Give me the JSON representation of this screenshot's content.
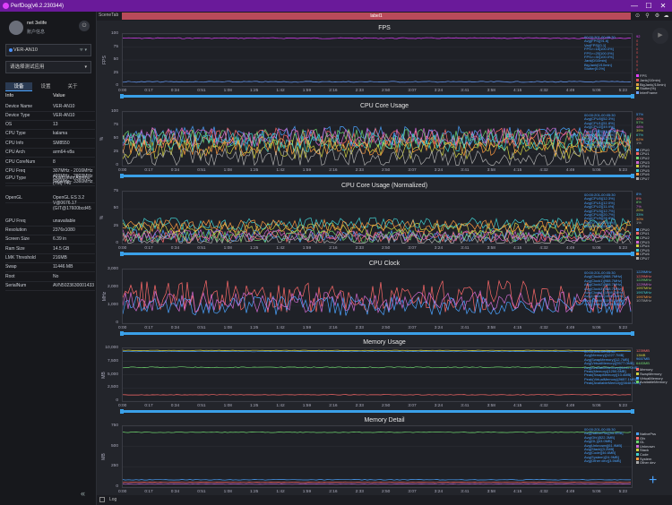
{
  "app_title": "PerfDog(v6.2.230344)",
  "window_controls": [
    "—",
    "☐",
    "✕"
  ],
  "user": {
    "name": "net 3elife",
    "verify": "账户信息"
  },
  "device": {
    "name": "VER-AN10",
    "wifi": "wifi"
  },
  "app_select": "请选择测试应用",
  "tabs": [
    "设备",
    "设置",
    "关于"
  ],
  "info_header": {
    "key": "Info",
    "value": "Value"
  },
  "info_rows": [
    {
      "k": "Device Name",
      "v": "VER-AN10"
    },
    {
      "k": "Device Type",
      "v": "VER-AN10"
    },
    {
      "k": "OS",
      "v": "13"
    },
    {
      "k": "CPU Type",
      "v": "kalama"
    },
    {
      "k": "CPU Info",
      "v": "SM8550"
    },
    {
      "k": "CPU Arch",
      "v": "arm64-v8a"
    },
    {
      "k": "CPU CoreNum",
      "v": "8"
    },
    {
      "k": "CPU Freq",
      "v": "307MHz - 2016MHz\n499MHz - 2803MHz\n595MHz - 3360MHz"
    },
    {
      "k": "GPU Type",
      "v": "Qualcomm Adreno (TM) 740"
    },
    {
      "k": "OpenGL",
      "v": "OpenGL ES 3.2 V@0676.17 (GIT@17600bcd45"
    },
    {
      "k": "GPU Freq",
      "v": "unavailable"
    },
    {
      "k": "Resolution",
      "v": "2376x1080"
    },
    {
      "k": "Screen Size",
      "v": "6.39 in"
    },
    {
      "k": "Ram Size",
      "v": "14.5 GB"
    },
    {
      "k": "LMK Threshold",
      "v": "216MB"
    },
    {
      "k": "Swap",
      "v": "11446 MB"
    },
    {
      "k": "Root",
      "v": "No"
    },
    {
      "k": "SerialNum",
      "v": "AVN5023630001433"
    }
  ],
  "toolbar": {
    "scene_tab": "SceneTab",
    "label": "label1"
  },
  "x_ticks": [
    "0:00",
    "0:17",
    "0:34",
    "0:51",
    "1:08",
    "1:25",
    "1:42",
    "1:59",
    "2:16",
    "2:33",
    "2:50",
    "3:07",
    "3:24",
    "3:41",
    "3:58",
    "4:15",
    "4:32",
    "4:49",
    "5:06",
    "5:23"
  ],
  "panels": [
    {
      "title": "FPS",
      "unit": "FPS",
      "yticks": [
        "100",
        "75",
        "50",
        "25",
        "0"
      ],
      "stats": [
        "00:00:201-00:05:30",
        "Avg(FPS)[91.6]",
        "Var(FPS)[0.1]",
        "FPS>=18[100.0%]",
        "FPS>=25[100.0%]",
        "FPS>=30[100.0%]",
        "Jank[0/10min]",
        "BigJank[0/10min]",
        "Stutter[0.0%]"
      ],
      "values": [
        "92",
        "0",
        "0",
        "0",
        "0",
        "0",
        "0",
        "0",
        "0"
      ],
      "legend": [
        {
          "n": "FPS",
          "c": "#e040fb"
        },
        {
          "n": "Jank(/10min)",
          "c": "#e05050"
        },
        {
          "n": "BigJank(/10min)",
          "c": "#e0a040"
        },
        {
          "n": "Stutter(%)",
          "c": "#d0d040"
        },
        {
          "n": "InterFrame",
          "c": "#6aa0ff"
        }
      ]
    },
    {
      "title": "CPU Core Usage",
      "unit": "%",
      "yticks": [
        "100",
        "75",
        "50",
        "25",
        "0"
      ],
      "stats": [
        "00:00:201-00:05:30",
        "Avg(CPU0)[52.3%]",
        "Avg(CPU1)[51.8%]",
        "Avg(CPU2)[49.9%]",
        "Avg(CPU3)[52.6%]",
        "Avg(CPU4)[30.1%]",
        "Avg(CPU5)[42.6%]",
        "Avg(CPU6)[36.1%]",
        "Avg(CPU7)[14.2%]"
      ],
      "values": [
        "57%",
        "40%",
        "57%",
        "48%",
        "39%",
        "67%",
        "62%",
        "1%"
      ],
      "legend": [
        {
          "n": "CPU0",
          "c": "#4aa3ff"
        },
        {
          "n": "CPU1",
          "c": "#ff6a6a"
        },
        {
          "n": "CPU2",
          "c": "#6ed36e"
        },
        {
          "n": "CPU3",
          "c": "#d06ad0"
        },
        {
          "n": "CPU4",
          "c": "#d0d040"
        },
        {
          "n": "CPU5",
          "c": "#40d0d0"
        },
        {
          "n": "CPU6",
          "c": "#ff9a40"
        },
        {
          "n": "CPU7",
          "c": "#aaaaaa"
        }
      ]
    },
    {
      "title": "CPU Core Usage (Normalized)",
      "unit": "%",
      "yticks": [
        "75",
        "50",
        "25",
        "0"
      ],
      "stats": [
        "00:00:201-00:05:30",
        "Avg(CPU0)[12.3%]",
        "Avg(CPU1)[12.0%]",
        "Avg(CPU2)[11.4%]",
        "Avg(CPU3)[12.7%]",
        "Avg(CPU4)[20.7%]",
        "Avg(CPU5)[28.8%]",
        "Avg(CPU6)[25.0%]",
        "Avg(CPU7)[5.6%]"
      ],
      "values": [
        "8%",
        "6%",
        "8%",
        "7%",
        "20%",
        "33%",
        "30%",
        "1%"
      ],
      "legend": [
        {
          "n": "CPU0",
          "c": "#4aa3ff"
        },
        {
          "n": "CPU1",
          "c": "#ff6a6a"
        },
        {
          "n": "CPU2",
          "c": "#6ed36e"
        },
        {
          "n": "CPU3",
          "c": "#d06ad0"
        },
        {
          "n": "CPU4",
          "c": "#d0d040"
        },
        {
          "n": "CPU5",
          "c": "#40d0d0"
        },
        {
          "n": "CPU6",
          "c": "#ff9a40"
        },
        {
          "n": "CPU7",
          "c": "#aaaaaa"
        }
      ]
    },
    {
      "title": "CPU Clock",
      "unit": "MHz",
      "yticks": [
        "3,000",
        "2,000",
        "1,000",
        "0"
      ],
      "stats": [
        "00:00:201-00:05:30",
        "Avg(Clock0)[988.7MHz]",
        "Avg(Clock1)[988.7MHz]",
        "Avg(Clock2)[988.7MHz]",
        "Avg(Clock3)[988.7MHz]",
        "Avg(Clock4)[1598.2MHz]",
        "Avg(Clock5)[1598.2MHz]",
        "Avg(Clock6)[1598.2MHz]",
        "Avg(Clock7)[1018.9MHz]"
      ],
      "values": [
        "1229MHz",
        "1229MHz",
        "1229MHz",
        "1229MHz",
        "1997MHz",
        "1997MHz",
        "1997MHz",
        "1075MHz"
      ],
      "legend": []
    },
    {
      "title": "Memory Usage",
      "unit": "MB",
      "yticks": [
        "10,000",
        "7,500",
        "5,000",
        "2,500",
        "0"
      ],
      "stats": [
        "00:00:201-00:05:30",
        "Avg(Memory)[1227.7MB]",
        "Avg(SwapMemory)[12.7MB]",
        "Avg(VirtualMemory)[9577.0MB]",
        "Avg(AvailableMemory)[6441.0MB]",
        "Peak(Memory)[1250.6MB]",
        "Peak(SwapMemory)[13.4MB]",
        "Peak(VirtualMemory)[9657.1MB]",
        "Peak(AvailableMemory)[6648.9MB]"
      ],
      "values": [
        "1239MB",
        "13MB",
        "9657MB",
        "6483MB"
      ],
      "legend": [
        {
          "n": "Memory",
          "c": "#ff6a6a"
        },
        {
          "n": "SwapMemory",
          "c": "#d0d040"
        },
        {
          "n": "VirtualMemory",
          "c": "#4aa3ff"
        },
        {
          "n": "AvailableMemory",
          "c": "#6ed36e"
        }
      ]
    },
    {
      "title": "Memory Detail",
      "unit": "MB",
      "yticks": [
        "750",
        "500",
        "250",
        "0"
      ],
      "stats": [
        "00:00:201-00:05:30",
        "Avg(NativePss)[95.4MB]",
        "Avg(Gfx)[522.3MB]",
        "Avg(GL)[43.0MB]",
        "Avg(Unknown)[61.9MB]",
        "Avg(Stack)[3.2MB]",
        "Avg(Code)[46.6MB]",
        "Avg(System)[24.9MB]",
        "Avg(Other dev)[3.5MB]"
      ],
      "values": [],
      "legend": [
        {
          "n": "NativePss",
          "c": "#4aa3ff"
        },
        {
          "n": "Gfx",
          "c": "#ff6a6a"
        },
        {
          "n": "GL",
          "c": "#6ed36e"
        },
        {
          "n": "Unknown",
          "c": "#d06ad0"
        },
        {
          "n": "Stack",
          "c": "#d0d040"
        },
        {
          "n": "Code",
          "c": "#40d0d0"
        },
        {
          "n": "System",
          "c": "#ff9a40"
        },
        {
          "n": "Other dev",
          "c": "#aaaaaa"
        }
      ]
    }
  ],
  "log_label": "Log",
  "colors": {
    "titlebar": "#6a1a9a",
    "accent": "#3aa0e8",
    "label": "#b84a5a"
  }
}
